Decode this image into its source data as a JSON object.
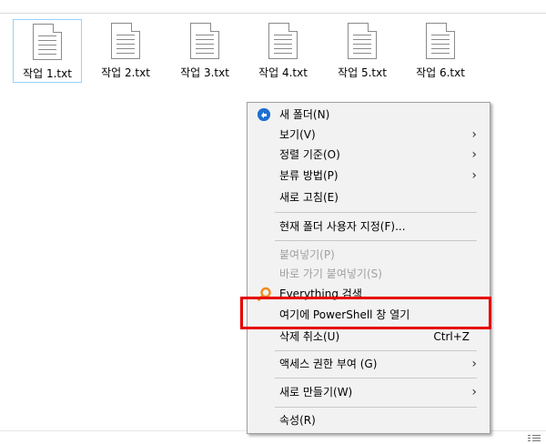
{
  "files": [
    {
      "name": "작업 1.txt",
      "selected": true
    },
    {
      "name": "작업 2.txt",
      "selected": false
    },
    {
      "name": "작업 3.txt",
      "selected": false
    },
    {
      "name": "작업 4.txt",
      "selected": false
    },
    {
      "name": "작업 5.txt",
      "selected": false
    },
    {
      "name": "작업 6.txt",
      "selected": false
    }
  ],
  "menu": {
    "new_folder": "새 폴더(N)",
    "view": "보기(V)",
    "sort_by": "정렬 기준(O)",
    "group_by": "분류 방법(P)",
    "refresh": "새로 고침(E)",
    "customize_folder": "현재 폴더 사용자 지정(F)...",
    "paste": "붙여넣기(P)",
    "paste_shortcut": "바로 가기 붙여넣기(S)",
    "everything_search": "Everything 검색",
    "open_powershell": "여기에 PowerShell 창 열기",
    "undo_delete": "삭제 취소(U)",
    "undo_shortcut": "Ctrl+Z",
    "give_access": "액세스 권한 부여 (G)",
    "new": "새로 만들기(W)",
    "properties": "속성(R)",
    "submenu_arrow": "›"
  },
  "colors": {
    "highlight_border": "#e60000",
    "new_folder_icon": "#1e6fd0",
    "everything_icon": "#f08a1c"
  },
  "icons": {
    "new_folder": "new-folder-icon",
    "everything": "everything-search-icon",
    "file": "text-file-icon",
    "view_toggle": "details-view-icon"
  }
}
